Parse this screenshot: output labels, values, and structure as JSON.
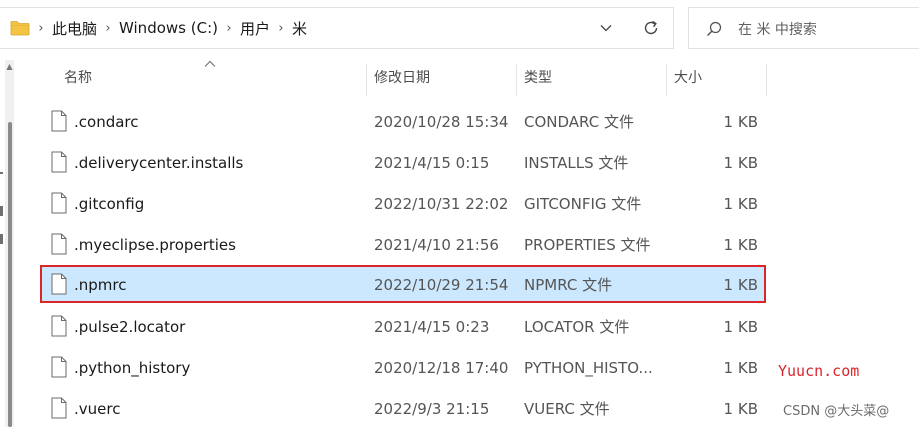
{
  "address_bar": {
    "breadcrumbs": [
      "此电脑",
      "Windows (C:)",
      "用户",
      "米"
    ],
    "separator": "›"
  },
  "search": {
    "placeholder": "在 米 中搜索"
  },
  "columns": {
    "name": "名称",
    "date": "修改日期",
    "type": "类型",
    "size": "大小"
  },
  "files": [
    {
      "name": ".condarc",
      "date": "2020/10/28 15:34",
      "type": "CONDARC 文件",
      "size": "1 KB",
      "selected": false
    },
    {
      "name": ".deliverycenter.installs",
      "date": "2021/4/15 0:15",
      "type": "INSTALLS 文件",
      "size": "1 KB",
      "selected": false
    },
    {
      "name": ".gitconfig",
      "date": "2022/10/31 22:02",
      "type": "GITCONFIG 文件",
      "size": "1 KB",
      "selected": false
    },
    {
      "name": ".myeclipse.properties",
      "date": "2021/4/10 21:56",
      "type": "PROPERTIES 文件",
      "size": "1 KB",
      "selected": false
    },
    {
      "name": ".npmrc",
      "date": "2022/10/29 21:54",
      "type": "NPMRC 文件",
      "size": "1 KB",
      "selected": true
    },
    {
      "name": ".pulse2.locator",
      "date": "2021/4/15 0:23",
      "type": "LOCATOR 文件",
      "size": "1 KB",
      "selected": false
    },
    {
      "name": ".python_history",
      "date": "2020/12/18 17:40",
      "type": "PYTHON_HISTO...",
      "size": "1 KB",
      "selected": false
    },
    {
      "name": ".vuerc",
      "date": "2022/9/3 21:15",
      "type": "VUERC 文件",
      "size": "1 KB",
      "selected": false
    }
  ],
  "colors": {
    "selection_bg": "#cce8ff",
    "highlight_border": "#d9262c",
    "folder": "#f4c542"
  },
  "watermarks": {
    "site": "Yuucn.com",
    "author": "CSDN @大头菜@"
  }
}
